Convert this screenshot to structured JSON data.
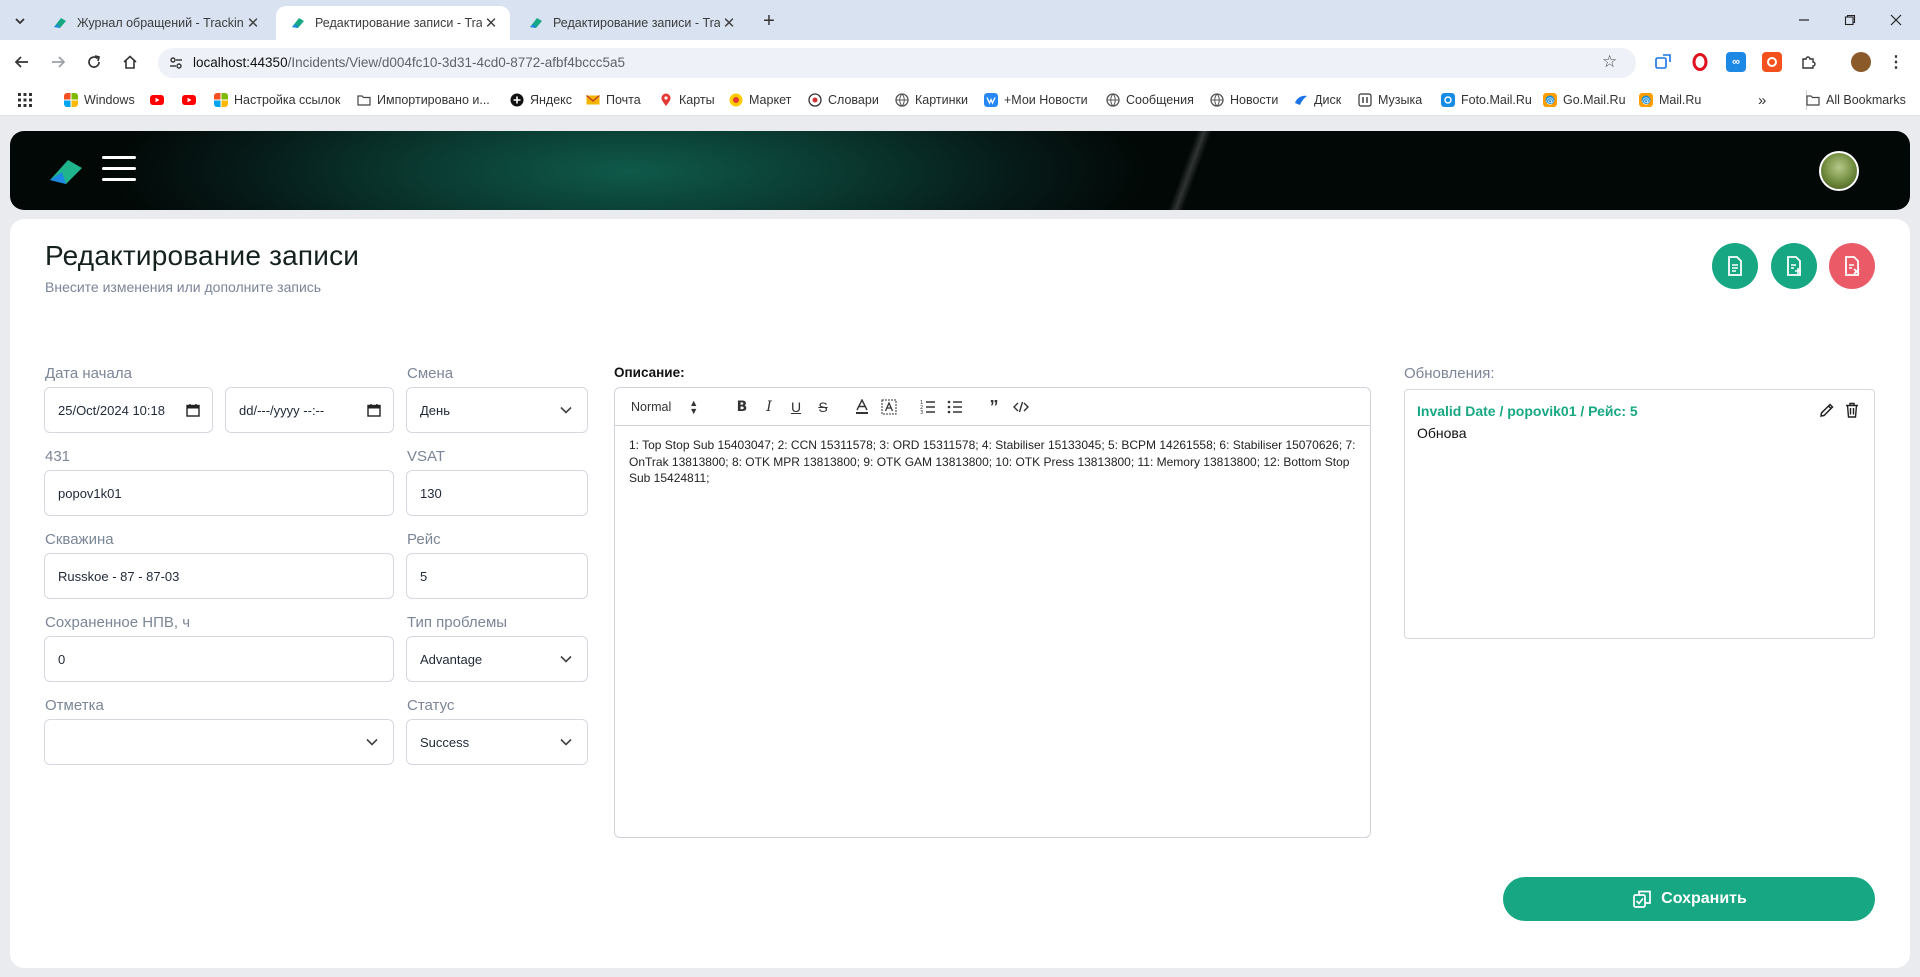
{
  "browser": {
    "tabs": [
      {
        "title": "Журнал обращений - Tracking",
        "active": false
      },
      {
        "title": "Редактирование записи - Track",
        "active": true
      },
      {
        "title": "Редактирование записи - Track",
        "active": false
      }
    ],
    "url_host": "localhost:44350",
    "url_path": "/Incidents/View/d004fc10-3d31-4cd0-8772-afbf4bccc5a5",
    "bookmarks": [
      {
        "label": "Windows",
        "icon": "windows-icon",
        "color": "#f25022"
      },
      {
        "label": "",
        "icon": "youtube-icon",
        "color": "#ff0000"
      },
      {
        "label": "",
        "icon": "youtube-icon",
        "color": "#ff0000"
      },
      {
        "label": "Настройка ссылок",
        "icon": "windows-icon",
        "color": "#f25022"
      },
      {
        "label": "Импортировано и...",
        "icon": "folder-icon",
        "color": "#555555"
      },
      {
        "label": "Яндекс",
        "icon": "yandex-icon",
        "color": "#111111"
      },
      {
        "label": "Почта",
        "icon": "mail-icon",
        "color": "#f5b400"
      },
      {
        "label": "Карты",
        "icon": "map-pin-icon",
        "color": "#e53935"
      },
      {
        "label": "Маркет",
        "icon": "market-icon",
        "color": "#ffcc00"
      },
      {
        "label": "Словари",
        "icon": "dictionary-icon",
        "color": "#cc3333"
      },
      {
        "label": "Картинки",
        "icon": "globe-icon",
        "color": "#555555"
      },
      {
        "label": "+Мои Новости",
        "icon": "vk-icon",
        "color": "#2787f5"
      },
      {
        "label": "Сообщения",
        "icon": "globe-icon",
        "color": "#555555"
      },
      {
        "label": "Новости",
        "icon": "globe-icon",
        "color": "#555555"
      },
      {
        "label": "Диск",
        "icon": "disk-icon",
        "color": "#1a73e8"
      },
      {
        "label": "Музыка",
        "icon": "music-icon",
        "color": "#333333"
      },
      {
        "label": "Foto.Mail.Ru",
        "icon": "foto-icon",
        "color": "#168de2"
      },
      {
        "label": "Go.Mail.Ru",
        "icon": "at-icon",
        "color": "#168de2"
      },
      {
        "label": "Mail.Ru",
        "icon": "at-icon",
        "color": "#168de2"
      }
    ],
    "more_bookmarks": "»",
    "all_bookmarks": "All Bookmarks"
  },
  "page": {
    "title": "Редактирование записи",
    "subtitle": "Внесите изменения или дополните запись"
  },
  "form": {
    "start_date_label": "Дата начала",
    "start_date_value": "25/Oct/2024 10:18",
    "end_date_value": "dd/---/yyyy --:--",
    "shift_label": "Смена",
    "shift_value": "День",
    "field431_label": "431",
    "field431_value": "popov1k01",
    "vsat_label": "VSAT",
    "vsat_value": "130",
    "well_label": "Скважина",
    "well_value": "Russkoe - 87 - 87-03",
    "trip_label": "Рейс",
    "trip_value": "5",
    "npv_label": "Сохраненное НПВ, ч",
    "npv_value": "0",
    "problem_label": "Тип проблемы",
    "problem_value": "Advantage",
    "mark_label": "Отметка",
    "mark_value": "",
    "status_label": "Статус",
    "status_value": "Success"
  },
  "editor": {
    "label": "Описание:",
    "format_value": "Normal",
    "content": "1: Top Stop Sub 15403047; 2: CCN 15311578; 3: ORD 15311578; 4: Stabiliser 15133045; 5: BCPM 14261558; 6: Stabiliser 15070626; 7: OnTrak 13813800; 8: OTK MPR 13813800; 9: OTK GAM 13813800; 10: OTK Press 13813800; 11: Memory 13813800; 12: Bottom Stop Sub 15424811;"
  },
  "updates": {
    "label": "Обновления:",
    "items": [
      {
        "header": "Invalid Date / popovik01 / Рейс: 5",
        "text": "Обнова"
      }
    ]
  },
  "actions": {
    "save_label": "Сохранить"
  },
  "colors": {
    "accent": "#17a883",
    "danger": "#ea5a67"
  }
}
